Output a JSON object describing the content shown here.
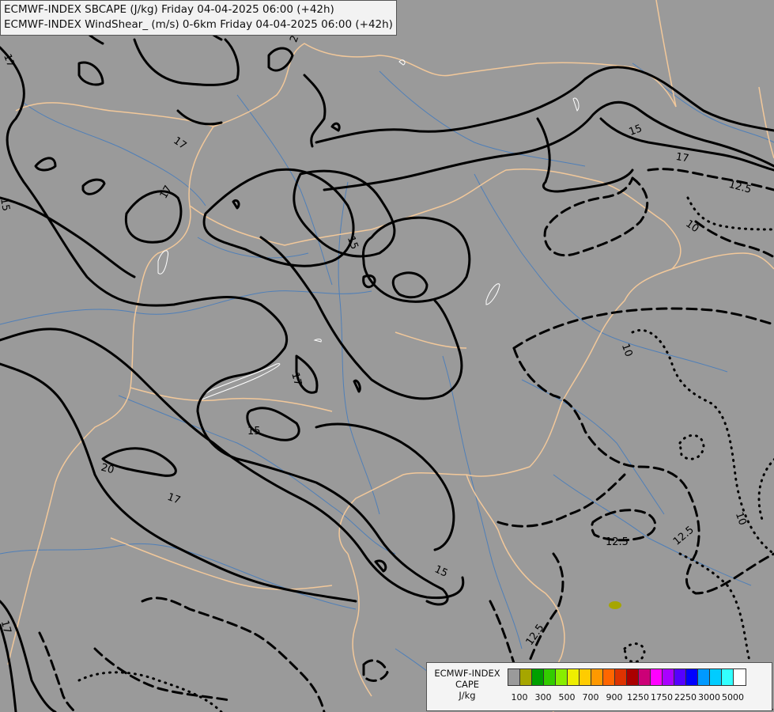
{
  "title_lines": [
    "ECMWF-INDEX SBCAPE (J/kg) Friday 04-04-2025 06:00 (+42h)",
    "ECMWF-INDEX WindShear_ (m/s) 0-6km Friday 04-04-2025 06:00 (+42h)"
  ],
  "colors": {
    "background": "#9a9a9a",
    "border_lines": "#f2c89a",
    "rivers": "#4f7fb8",
    "contours": "#000000"
  },
  "contour_labels": [
    "17",
    "17",
    "17",
    "15",
    "15",
    "17",
    "15",
    "20",
    "17",
    "15",
    "17",
    "15",
    "12.5",
    "10",
    "10",
    "12.5",
    "12.5",
    "10",
    "12.5",
    "2"
  ],
  "legend": {
    "title_lines": [
      "ECMWF-INDEX",
      "CAPE",
      "J/kg"
    ],
    "tick_labels": [
      "100",
      "300",
      "500",
      "700",
      "900",
      "1250",
      "1750",
      "2250",
      "3000",
      "5000"
    ],
    "swatch_colors": [
      "#9a9a9a",
      "#a6a600",
      "#00a000",
      "#33cc00",
      "#88ee00",
      "#eeee00",
      "#ffcc00",
      "#ff9900",
      "#ff6600",
      "#dd3300",
      "#aa0000",
      "#cc0077",
      "#ff00ff",
      "#aa00ff",
      "#5500ff",
      "#0000ff",
      "#0099ff",
      "#00ccff",
      "#33ffff",
      "#ffffff"
    ]
  }
}
